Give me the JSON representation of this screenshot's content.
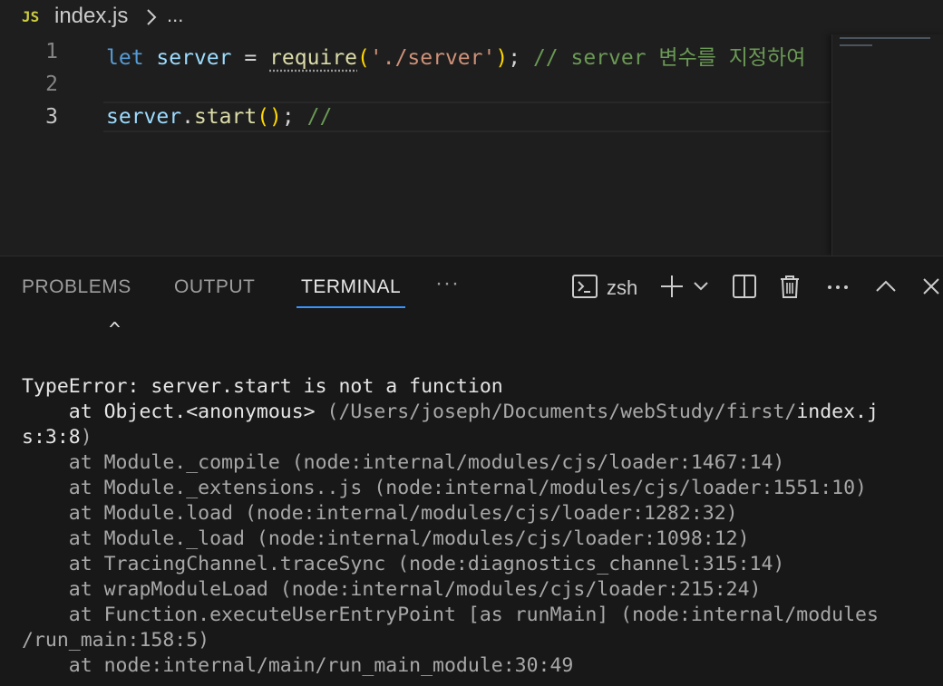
{
  "breadcrumb": {
    "language_badge": "JS",
    "file": "index.js",
    "more": "..."
  },
  "editor": {
    "line_numbers": [
      "1",
      "2",
      "3"
    ],
    "active_line": "3",
    "line1": {
      "kw": "let",
      "var": "server",
      "op": "=",
      "fn": "require",
      "open": "(",
      "str": "'./server'",
      "close": ")",
      "semi": ";",
      "comment": "// server 변수를 지정하여"
    },
    "line3": {
      "var": "server",
      "dot": ".",
      "fn": "start",
      "parens": "()",
      "semi": ";",
      "comment": "//"
    }
  },
  "panel": {
    "tabs": [
      "PROBLEMS",
      "OUTPUT",
      "TERMINAL"
    ],
    "active_tab": "TERMINAL",
    "more_tabs": "···",
    "shell": "zsh",
    "accent_color": "#3794ff"
  },
  "terminal": {
    "caret": "^",
    "error_message": "TypeError: server.start is not a function",
    "stack": [
      {
        "prefix": "    at Object.<anonymous> ",
        "dim": "(/Users/joseph/Documents/webStudy/first/",
        "bright": "index.j"
      },
      {
        "bright": "s:3:8",
        "dim": ")"
      },
      {
        "text": "    at Module._compile (node:internal/modules/cjs/loader:1467:14)"
      },
      {
        "text": "    at Module._extensions..js (node:internal/modules/cjs/loader:1551:10)"
      },
      {
        "text": "    at Module.load (node:internal/modules/cjs/loader:1282:32)"
      },
      {
        "text": "    at Module._load (node:internal/modules/cjs/loader:1098:12)"
      },
      {
        "text": "    at TracingChannel.traceSync (node:diagnostics_channel:315:14)"
      },
      {
        "text": "    at wrapModuleLoad (node:internal/modules/cjs/loader:215:24)"
      },
      {
        "text": "    at Function.executeUserEntryPoint [as runMain] (node:internal/modules"
      },
      {
        "text": "/run_main:158:5)"
      },
      {
        "text": "    at node:internal/main/run_main_module:30:49"
      }
    ]
  }
}
